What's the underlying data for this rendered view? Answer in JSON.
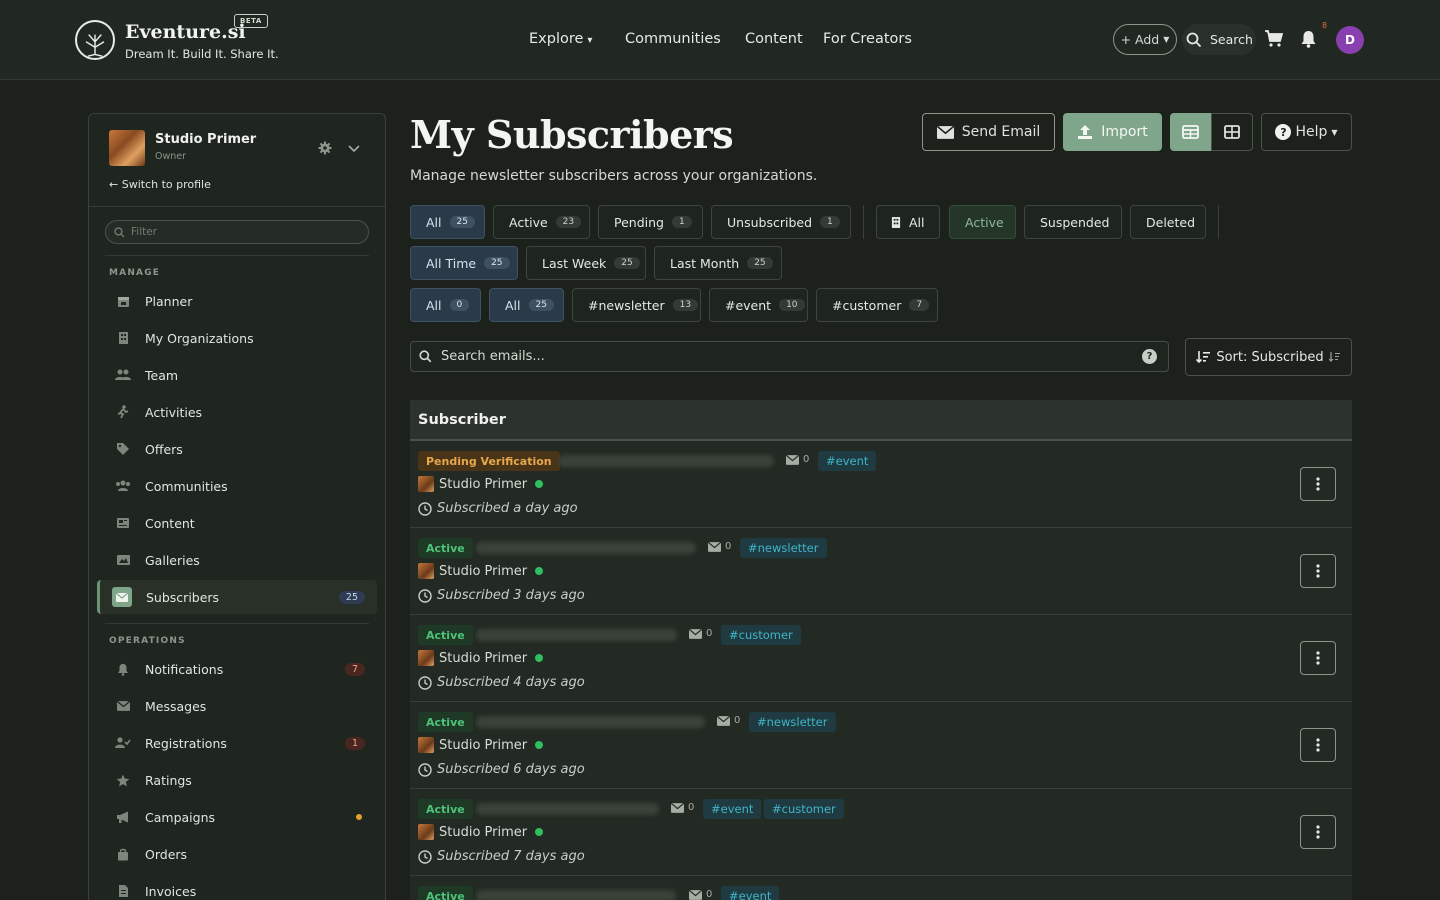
{
  "brand": {
    "name": "Eventure.si",
    "badge": "BETA",
    "tagline": "Dream It. Build It. Share It."
  },
  "nav": {
    "links": [
      "Explore",
      "Communities",
      "Content",
      "For Creators"
    ],
    "add_label": "+ Add",
    "search_label": "Search",
    "notification_count": "8",
    "avatar_initial": "D"
  },
  "sidebar": {
    "org_name": "Studio Primer",
    "org_role": "Owner",
    "switch_label": "Switch to profile",
    "filter_placeholder": "Filter",
    "manage_label": "MANAGE",
    "operations_label": "OPERATIONS",
    "manage_items": [
      {
        "label": "Planner",
        "icon": "calendar-icon"
      },
      {
        "label": "My Organizations",
        "icon": "building-icon"
      },
      {
        "label": "Team",
        "icon": "team-icon"
      },
      {
        "label": "Activities",
        "icon": "running-icon"
      },
      {
        "label": "Offers",
        "icon": "tag-icon"
      },
      {
        "label": "Communities",
        "icon": "users-icon"
      },
      {
        "label": "Content",
        "icon": "newspaper-icon"
      },
      {
        "label": "Galleries",
        "icon": "images-icon"
      },
      {
        "label": "Subscribers",
        "icon": "envelope-icon",
        "count": "25"
      }
    ],
    "operations_items": [
      {
        "label": "Notifications",
        "icon": "bell-icon",
        "count": "7"
      },
      {
        "label": "Messages",
        "icon": "envelope-icon"
      },
      {
        "label": "Registrations",
        "icon": "user-check-icon",
        "count": "1"
      },
      {
        "label": "Ratings",
        "icon": "star-icon"
      },
      {
        "label": "Campaigns",
        "icon": "megaphone-icon"
      },
      {
        "label": "Orders",
        "icon": "bag-icon"
      },
      {
        "label": "Invoices",
        "icon": "invoice-icon"
      }
    ]
  },
  "page": {
    "title": "My Subscribers",
    "subtitle": "Manage newsletter subscribers across your organizations.",
    "send_email": "Send Email",
    "import": "Import",
    "help": "Help"
  },
  "filters": {
    "status": [
      {
        "label": "All",
        "count": "25"
      },
      {
        "label": "Active",
        "count": "23"
      },
      {
        "label": "Pending",
        "count": "1"
      },
      {
        "label": "Unsubscribed",
        "count": "1"
      }
    ],
    "org_state": [
      "All",
      "Active",
      "Suspended",
      "Deleted"
    ],
    "time": [
      {
        "label": "All Time",
        "count": "25"
      },
      {
        "label": "Last Week",
        "count": "25"
      },
      {
        "label": "Last Month",
        "count": "25"
      }
    ],
    "tags": [
      {
        "label": "All",
        "count": "0"
      },
      {
        "label": "All",
        "count": "25"
      },
      {
        "label": "#newsletter",
        "count": "13"
      },
      {
        "label": "#event",
        "count": "10"
      },
      {
        "label": "#customer",
        "count": "7"
      }
    ]
  },
  "search": {
    "placeholder": "Search emails...",
    "help": "?"
  },
  "sort_label": "Sort: Subscribed",
  "table": {
    "header": "Subscriber",
    "rows": [
      {
        "status": "Pending Verification",
        "mail_count": "0",
        "tags": [
          "#event"
        ],
        "org": "Studio Primer",
        "time": "Subscribed a day ago"
      },
      {
        "status": "Active",
        "mail_count": "0",
        "tags": [
          "#newsletter"
        ],
        "org": "Studio Primer",
        "time": "Subscribed 3 days ago"
      },
      {
        "status": "Active",
        "mail_count": "0",
        "tags": [
          "#customer"
        ],
        "org": "Studio Primer",
        "time": "Subscribed 4 days ago"
      },
      {
        "status": "Active",
        "mail_count": "0",
        "tags": [
          "#newsletter"
        ],
        "org": "Studio Primer",
        "time": "Subscribed 6 days ago"
      },
      {
        "status": "Active",
        "mail_count": "0",
        "tags": [
          "#event",
          "#customer"
        ],
        "org": "Studio Primer",
        "time": "Subscribed 7 days ago"
      },
      {
        "status": "Active",
        "mail_count": "0",
        "tags": [
          "#event"
        ],
        "org": "",
        "time": ""
      }
    ]
  },
  "colors": {
    "accent": "#7fa58a",
    "active_status": "#4fc27a",
    "pending_status": "#e6a84a",
    "tag_text": "#3fb5c8"
  }
}
